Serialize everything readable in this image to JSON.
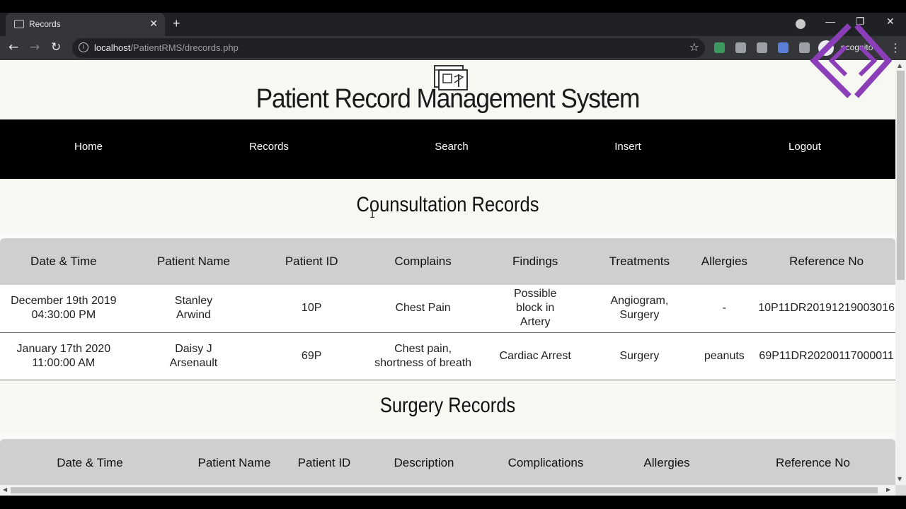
{
  "browser": {
    "tab_title": "Records",
    "tab_close": "✕",
    "new_tab": "+",
    "url_host": "localhost",
    "url_path": "/PatientRMS/drecords.php",
    "incognito_label": "ncognito",
    "window_minimize": "—",
    "window_restore": "❐",
    "window_close": "✕"
  },
  "site": {
    "title": "Patient Record Management System"
  },
  "nav": {
    "items": [
      "Home",
      "Records",
      "Search",
      "Insert",
      "Logout"
    ]
  },
  "consultation": {
    "title": "Counsultation Records",
    "headers": [
      "Date & Time",
      "Patient Name",
      "Patient ID",
      "Complains",
      "Findings",
      "Treatments",
      "Allergies",
      "Reference No"
    ],
    "rows": [
      [
        "December 19th 2019 04:30:00 PM",
        "Stanley Arwind",
        "10P",
        "Chest Pain",
        "Possible block in Artery",
        "Angiogram, Surgery",
        "-",
        "10P11DR20191219003016"
      ],
      [
        "January 17th 2020 11:00:00 AM",
        "Daisy J Arsenault",
        "69P",
        "Chest pain, shortness of breath",
        "Cardiac Arrest",
        "Surgery",
        "peanuts",
        "69P11DR20200117000011"
      ]
    ]
  },
  "surgery": {
    "title": "Surgery Records",
    "headers": [
      "Date & Time",
      "Patient Name",
      "Patient ID",
      "Description",
      "Complications",
      "Allergies",
      "Reference No"
    ]
  }
}
